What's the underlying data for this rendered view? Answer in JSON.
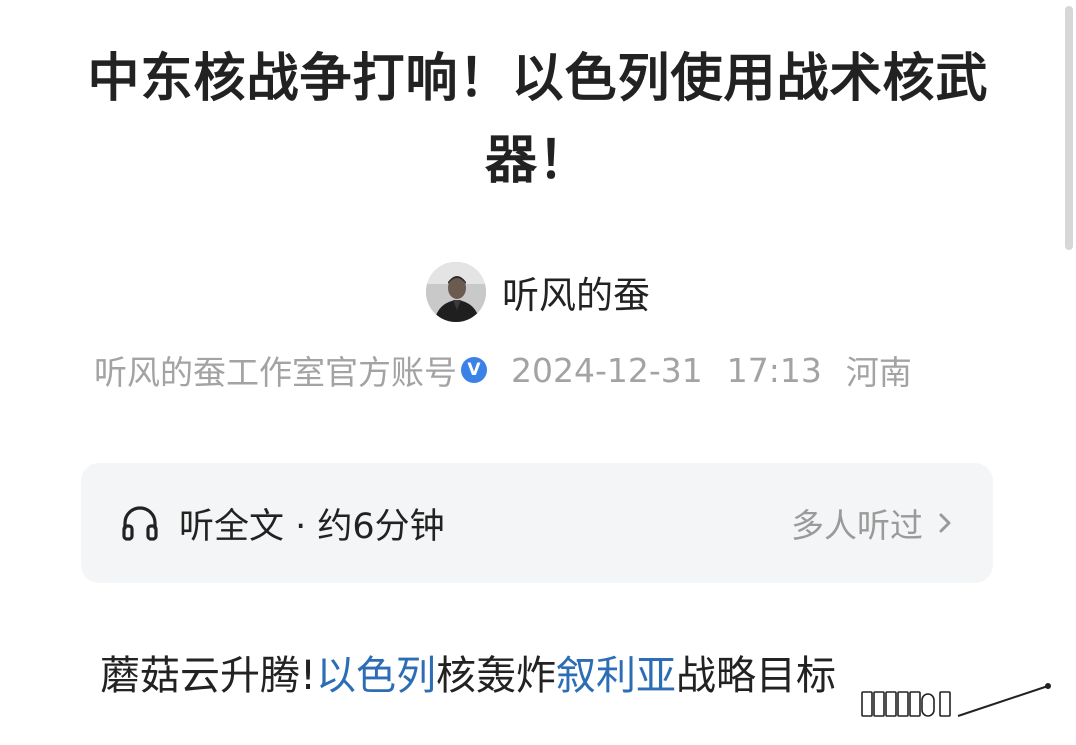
{
  "article": {
    "title": "中东核战争打响！以色列使用战术核武器！"
  },
  "author": {
    "name": "听风的蚕"
  },
  "meta": {
    "account": "听风的蚕工作室官方账号",
    "verified_mark": "V",
    "date": "2024-12-31",
    "time": "17:13",
    "location": "河南"
  },
  "audio": {
    "label": "听全文 · 约6分钟",
    "listeners": "多人听过"
  },
  "summary": {
    "part1": "蘑菇云升腾!",
    "link1": "以色列",
    "part2": "核轰炸",
    "link2": "叙利亚",
    "part3": "战略目标"
  },
  "colors": {
    "link": "#2c6db6",
    "verified": "#3b82e8",
    "card_bg": "#f4f5f6",
    "meta_text": "#a3a3a3"
  },
  "icons": {
    "verified": "verified-badge-icon",
    "audio": "headphone-icon",
    "listeners": "chevron-right-icon"
  }
}
